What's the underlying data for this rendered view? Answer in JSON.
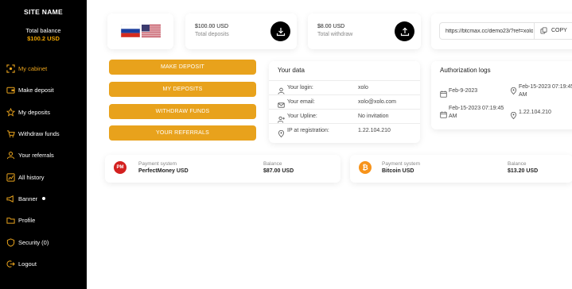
{
  "sidebar": {
    "site_name": "SITE NAME",
    "balance_label": "Total balance",
    "balance_value": "$100.2 USD",
    "items": [
      {
        "label": "My cabinet",
        "icon": "cabinet-icon",
        "active": true
      },
      {
        "label": "Make deposit",
        "icon": "wallet-icon"
      },
      {
        "label": "My deposits",
        "icon": "star-icon"
      },
      {
        "label": "Withdraw funds",
        "icon": "cart-icon"
      },
      {
        "label": "Your referrals",
        "icon": "users-icon"
      },
      {
        "label": "All history",
        "icon": "chart-icon"
      },
      {
        "label": "Banner",
        "icon": "megaphone-icon"
      },
      {
        "label": "Profile",
        "icon": "folder-icon"
      },
      {
        "label": "Security (0)",
        "icon": "shield-icon"
      },
      {
        "label": "Logout",
        "icon": "logout-icon"
      }
    ]
  },
  "stats": {
    "deposits_value": "$100.00 USD",
    "deposits_label": "Total deposits",
    "withdraw_value": "$8.00 USD",
    "withdraw_label": "Total withdraw"
  },
  "referral": {
    "url": "https://btcmax.cc/demo23/?ref=xolo",
    "copy_label": "COPY"
  },
  "actions": {
    "make_deposit": "MAKE DEPOSIT",
    "my_deposits": "MY DEPOSITS",
    "withdraw_funds": "WITHDRAW FUNDS",
    "your_referrals": "YOUR REFERRALS"
  },
  "your_data": {
    "title": "Your data",
    "rows": [
      {
        "label": "Your login:",
        "value": "xolo"
      },
      {
        "label": "Your email:",
        "value": "xolo@xolo.com"
      },
      {
        "label": "Your Upline:",
        "value": "No invitation"
      },
      {
        "label": "IP at registration:",
        "value": "1.22.104.210"
      }
    ]
  },
  "auth_logs": {
    "title": "Authorization logs",
    "rows": [
      {
        "date": "Feb-9-2023",
        "time": "Feb-15-2023 07:19:45 AM"
      },
      {
        "date": "Feb-15-2023 07:19:45 AM",
        "time": "1.22.104.210"
      }
    ]
  },
  "payments": [
    {
      "system_label": "Payment system",
      "system": "PerfectMoney USD",
      "balance_label": "Balance",
      "balance": "$87.00 USD",
      "icon": "PM",
      "color": "#d3201f"
    },
    {
      "system_label": "Payment system",
      "system": "Bitcoin USD",
      "balance_label": "Balance",
      "balance": "$13.20 USD",
      "icon": "₿",
      "color": "#f7931a"
    }
  ],
  "colors": {
    "accent": "#e8a21c",
    "sidebar_bg": "#000000"
  }
}
